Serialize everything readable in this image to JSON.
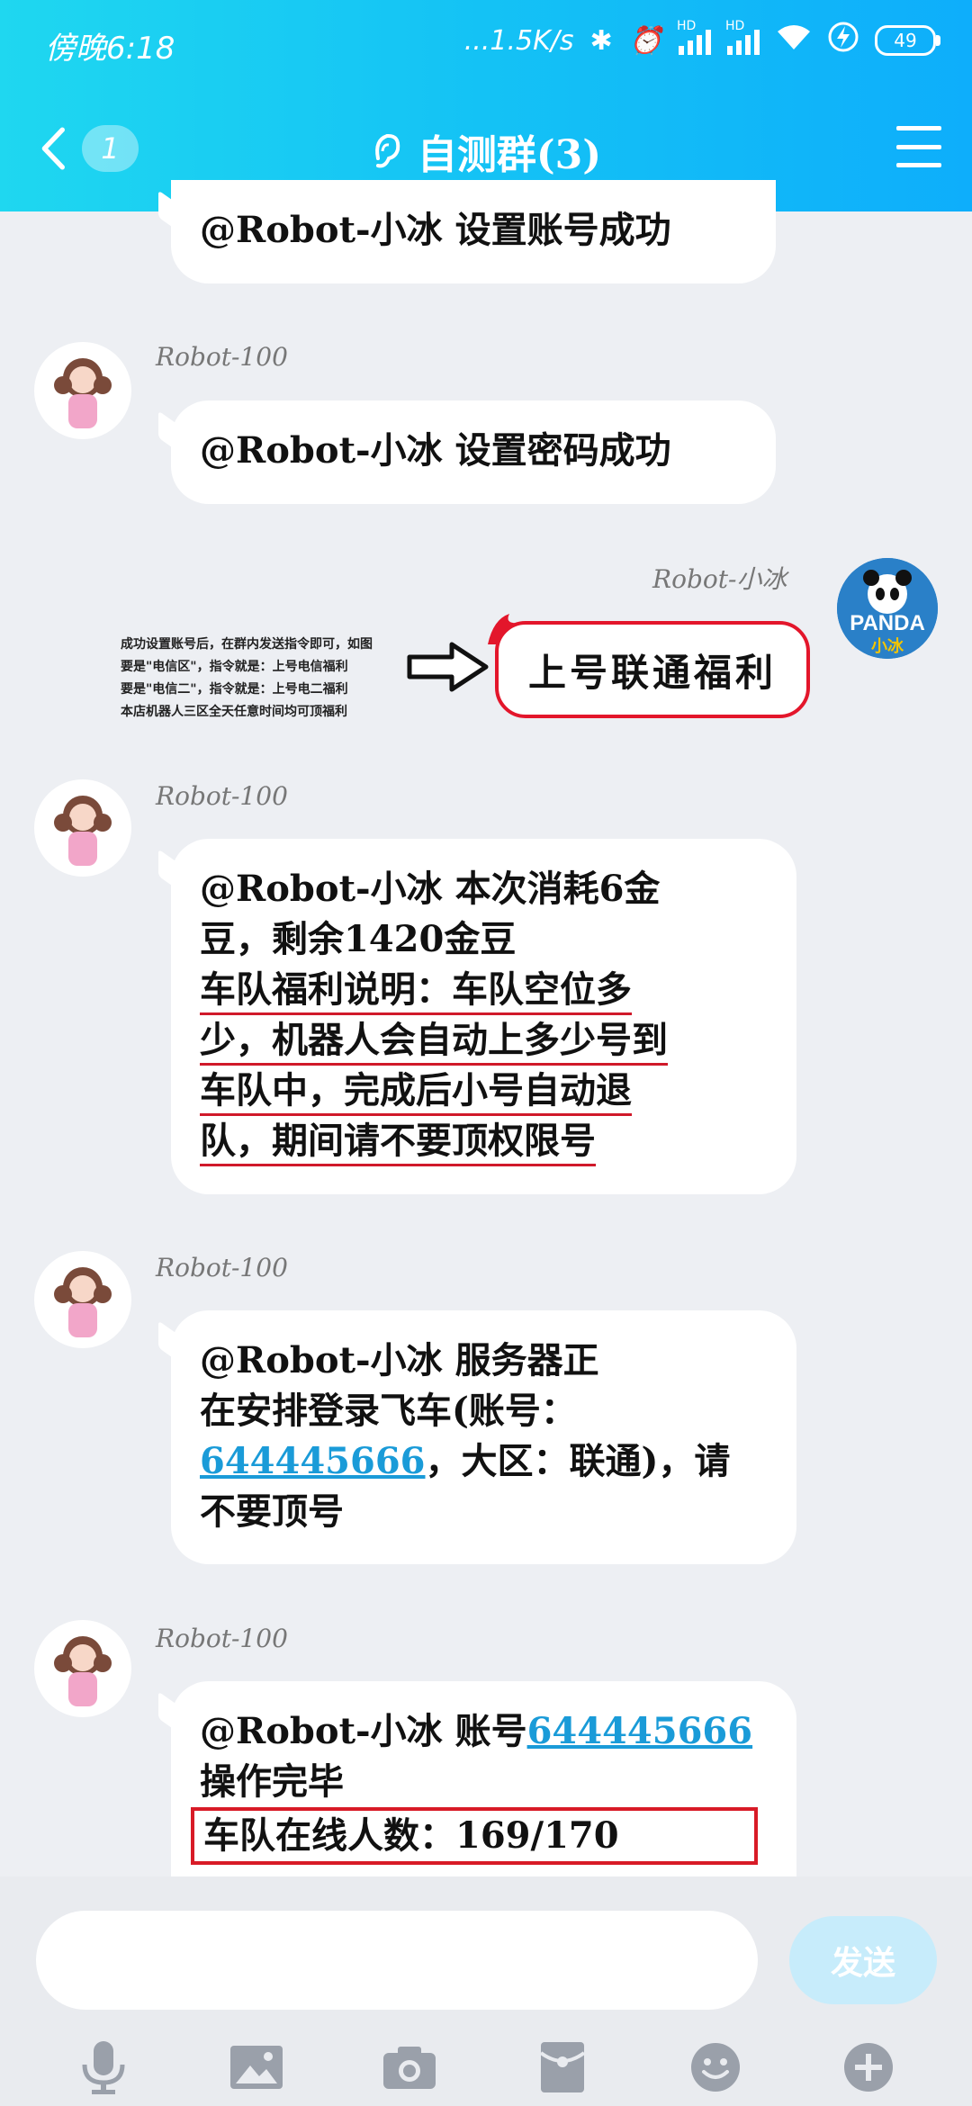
{
  "status_bar": {
    "time": "傍晚6:18",
    "network_speed": "...1.5K/s",
    "hd1": "HD",
    "hd2": "HD",
    "battery": "49"
  },
  "header": {
    "back_count": "1",
    "title": "自测群(3)"
  },
  "messages": [
    {
      "sender": "",
      "text": "@Robot-小冰  设置账号成功"
    },
    {
      "sender": "Robot-100",
      "text": "@Robot-小冰  设置密码成功"
    },
    {
      "sender": "Robot-小冰",
      "text": "上号联通福利",
      "note_lines": [
        "成功设置账号后，在群内发送指令即可，如图",
        "要是\"电信区\"，指令就是：上号电信福利",
        "要是\"电信二\"，指令就是：上号电二福利",
        "本店机器人三区全天任意时间均可顶福利"
      ]
    },
    {
      "sender": "Robot-100",
      "line1": "@Robot-小冰  本次消耗6金",
      "line2": "豆，剩余1420金豆",
      "line3": "车队福利说明：车队空位多",
      "line4": "少，机器人会自动上多少号到",
      "line5": "车队中，完成后小号自动退",
      "line6": "队，期间请不要顶权限号"
    },
    {
      "sender": "Robot-100",
      "line1": "@Robot-小冰  服务器正",
      "line2": "在安排登录飞车(账号：",
      "account": "644445666",
      "line3_rest": "，大区：联通)，请",
      "line4": "不要顶号"
    },
    {
      "sender": "Robot-100",
      "line1": "@Robot-小冰  账号",
      "account": "644445666",
      "line2": "操作完毕",
      "line3": "车队在线人数：169/170"
    }
  ],
  "input": {
    "send_label": "发送"
  },
  "colors": {
    "header_start": "#1fd7f0",
    "header_end": "#0eaefb",
    "link": "#1a9bd8",
    "highlight_red": "#d81b27"
  }
}
